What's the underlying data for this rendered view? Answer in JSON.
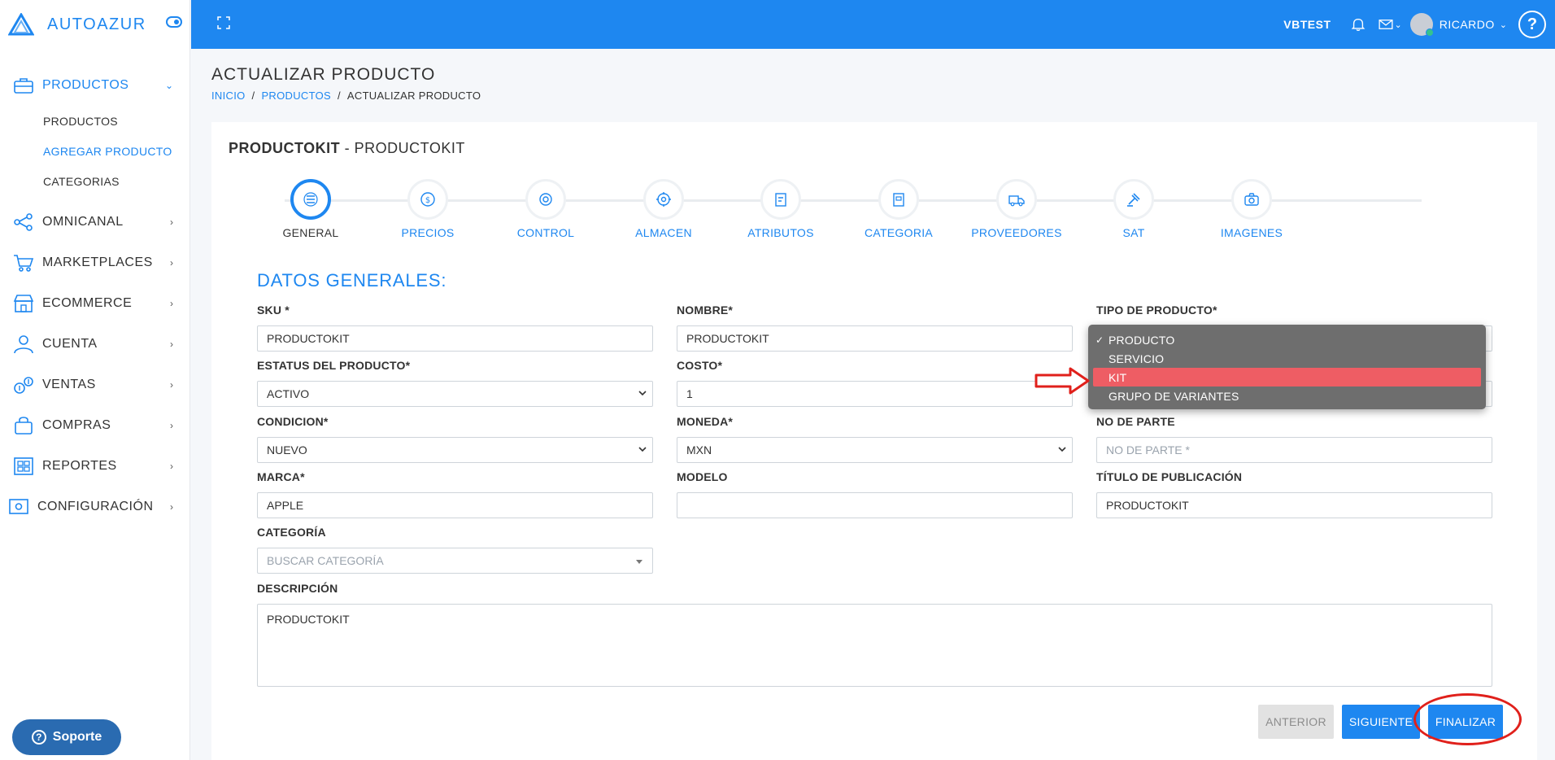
{
  "brand": {
    "name": "AUTOAZUR"
  },
  "sidebar": {
    "items": [
      {
        "label": "PRODUCTOS",
        "icon": "briefcase-icon"
      },
      {
        "label": "OMNICANAL",
        "icon": "share-icon"
      },
      {
        "label": "MARKETPLACES",
        "icon": "cart-icon"
      },
      {
        "label": "ECOMMERCE",
        "icon": "store-icon"
      },
      {
        "label": "CUENTA",
        "icon": "user-icon"
      },
      {
        "label": "VENTAS",
        "icon": "money-icon"
      },
      {
        "label": "COMPRAS",
        "icon": "bag-icon"
      },
      {
        "label": "REPORTES",
        "icon": "report-icon"
      },
      {
        "label": "CONFIGURACIÓN",
        "icon": "settings-icon"
      }
    ],
    "subitems": [
      "PRODUCTOS",
      "AGREGAR PRODUCTO",
      "CATEGORIAS"
    ],
    "support_label": "Soporte"
  },
  "topbar": {
    "company": "VBTEST",
    "user": "RICARDO",
    "help": "?"
  },
  "page": {
    "title": "ACTUALIZAR PRODUCTO",
    "breadcrumb": [
      "INICIO",
      "PRODUCTOS",
      "ACTUALIZAR PRODUCTO"
    ],
    "breadcrumb_sep": "/"
  },
  "card": {
    "title_bold": "PRODUCTOKIT",
    "title_rest": " - PRODUCTOKIT",
    "section_title": "DATOS GENERALES:"
  },
  "steps": [
    "GENERAL",
    "PRECIOS",
    "CONTROL",
    "ALMACEN",
    "ATRIBUTOS",
    "CATEGORIA",
    "PROVEEDORES",
    "SAT",
    "IMAGENES"
  ],
  "form": {
    "sku": {
      "label": "SKU *",
      "value": "PRODUCTOKIT"
    },
    "nombre": {
      "label": "NOMBRE*",
      "value": "PRODUCTOKIT"
    },
    "tipo": {
      "label": "TIPO DE PRODUCTO*",
      "options": [
        "PRODUCTO",
        "SERVICIO",
        "KIT",
        "GRUPO DE VARIANTES"
      ],
      "selected": "PRODUCTO",
      "highlighted": "KIT"
    },
    "estatus": {
      "label": "ESTATUS DEL PRODUCTO*",
      "value": "ACTIVO"
    },
    "costo": {
      "label": "COSTO*",
      "value": "1"
    },
    "condicion": {
      "label": "CONDICION*",
      "value": "NUEVO"
    },
    "moneda": {
      "label": "MONEDA*",
      "value": "MXN"
    },
    "no_parte": {
      "label": "NO DE PARTE",
      "placeholder": "NO DE PARTE *"
    },
    "marca": {
      "label": "MARCA*",
      "value": "APPLE"
    },
    "modelo": {
      "label": "MODELO",
      "value": ""
    },
    "titulo": {
      "label": "TÍTULO DE PUBLICACIÓN",
      "value": "PRODUCTOKIT"
    },
    "categoria": {
      "label": "CATEGORÍA",
      "placeholder": "BUSCAR CATEGORÍA"
    },
    "descripcion": {
      "label": "DESCRIPCIÓN",
      "value": "PRODUCTOKIT"
    }
  },
  "buttons": {
    "prev": "ANTERIOR",
    "next": "SIGUIENTE",
    "finish": "FINALIZAR"
  },
  "colors": {
    "primary": "#1e87f0",
    "highlight": "#ee5d64",
    "annotation": "#e0201b"
  }
}
